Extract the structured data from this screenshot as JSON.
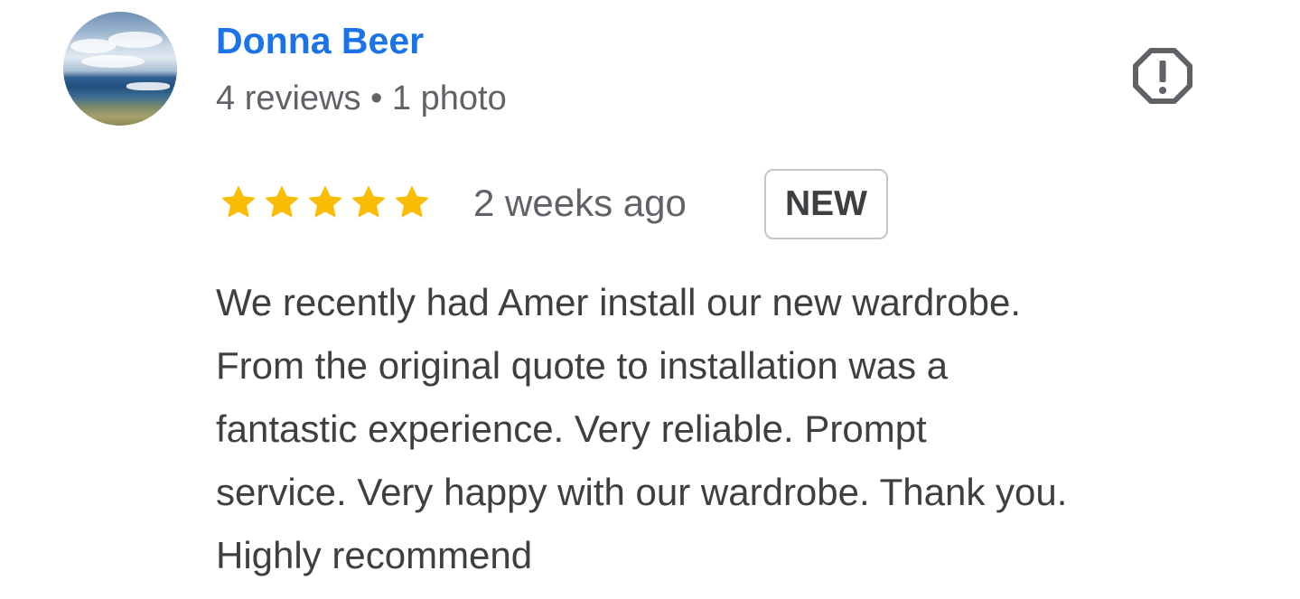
{
  "review": {
    "author": {
      "name": "Donna Beer",
      "meta": "4 reviews • 1 photo",
      "avatar_icon": "avatar-landscape-photo"
    },
    "report_icon": "report-octagon-icon",
    "rating": 5,
    "max_rating": 5,
    "star_color": "#fbbc04",
    "time_ago": "2 weeks ago",
    "badge": "NEW",
    "text_lines": [
      "We recently had Amer install our new wardrobe.",
      "From the original quote to installation was a",
      "fantastic experience. Very reliable. Prompt",
      "service. Very happy with our wardrobe. Thank you.",
      "Highly recommend"
    ]
  },
  "colors": {
    "name_link": "#1a73e8",
    "secondary_text": "#5f6368",
    "body_text": "#3c4043"
  }
}
